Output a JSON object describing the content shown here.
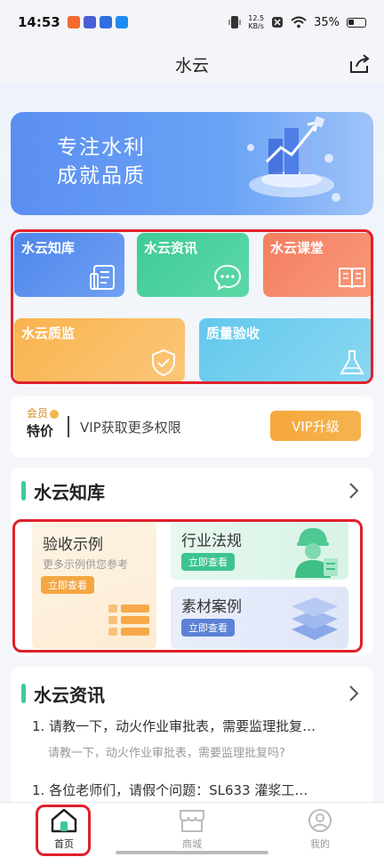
{
  "status_bar": {
    "time": "14:53",
    "net_speed_value": "12.5",
    "net_speed_unit": "KB/s",
    "battery": "35%",
    "app_icon_colors": [
      "#f26a2d",
      "#4a5fd6",
      "#2f6fe0",
      "#1b8cf0"
    ]
  },
  "header": {
    "title": "水云"
  },
  "banner": {
    "line1": "专注水利",
    "line2": "成就品质"
  },
  "grid": {
    "tiles": [
      {
        "label": "水云知库",
        "icon": "document-icon"
      },
      {
        "label": "水云资讯",
        "icon": "chat-bubble-icon"
      },
      {
        "label": "水云课堂",
        "icon": "open-book-icon"
      },
      {
        "label": "水云质监",
        "icon": "shield-check-icon"
      },
      {
        "label": "质量验收",
        "icon": "flask-icon"
      }
    ]
  },
  "vip": {
    "member_label": "会员",
    "special_label": "特价",
    "description": "VIP获取更多权限",
    "button_label": "VIP升级"
  },
  "knowledge": {
    "title": "水云知库",
    "left": {
      "title": "验收示例",
      "subtitle": "更多示例供您参考",
      "button": "立即查看"
    },
    "right_top": {
      "title": "行业法规",
      "button": "立即查看"
    },
    "right_bottom": {
      "title": "素材案例",
      "button": "立即查看"
    }
  },
  "news": {
    "title": "水云资讯",
    "items": [
      {
        "title": "1. 请教一下，动火作业审批表，需要监理批复…",
        "subtitle": "请教一下，动火作业审批表，需要监理批复吗?"
      },
      {
        "title": "1. 各位老师们，请假个问题：SL633 灌浆工…"
      }
    ]
  },
  "tabbar": {
    "tabs": [
      {
        "label": "首页",
        "icon": "home-icon",
        "active": true
      },
      {
        "label": "商城",
        "icon": "store-icon",
        "active": false
      },
      {
        "label": "我的",
        "icon": "profile-icon",
        "active": false
      }
    ]
  },
  "colors": {
    "accent_green": "#3ecb96",
    "highlight_red": "#e0202a",
    "vip_orange": "#f6a83a"
  }
}
